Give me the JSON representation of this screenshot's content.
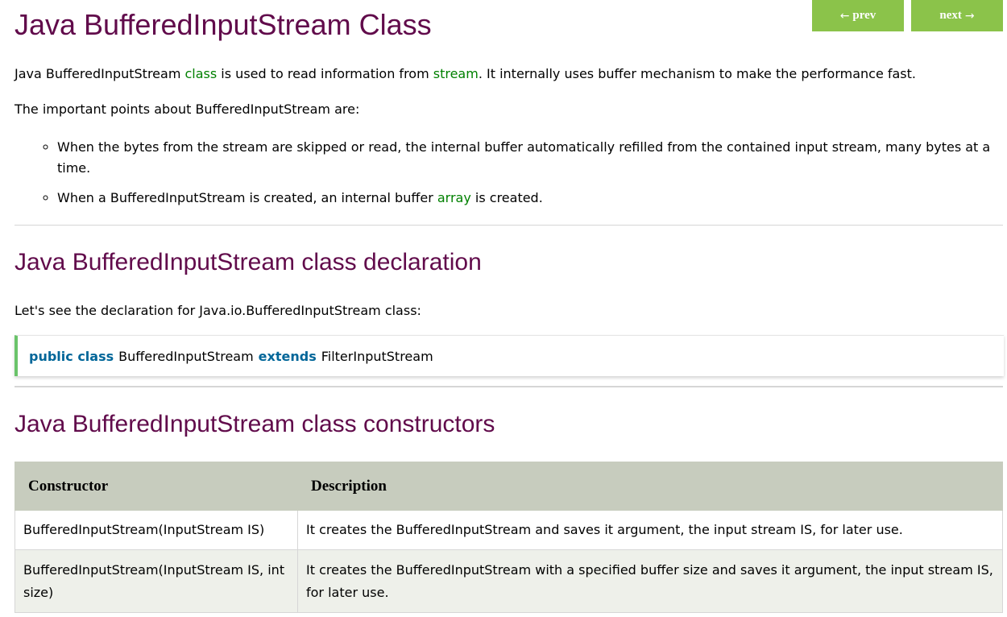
{
  "title": "Java BufferedInputStream Class",
  "nav": {
    "prev": "prev",
    "next": "next",
    "prev_arrow": "←",
    "next_arrow": "→"
  },
  "intro": {
    "before_class": "Java BufferedInputStream ",
    "class_link": "class",
    "middle": " is used to read information from ",
    "stream_link": "stream",
    "after": ". It internally uses buffer mechanism to make the performance fast."
  },
  "points_heading": "The important points about BufferedInputStream are:",
  "points": {
    "p1": "When the bytes from the stream are skipped or read, the internal buffer automatically refilled from the contained input stream, many bytes at a time.",
    "p2_before": "When a BufferedInputStream is created, an internal buffer ",
    "p2_link": "array",
    "p2_after": " is created."
  },
  "declaration": {
    "heading": "Java BufferedInputStream class declaration",
    "text": "Let's see the declaration for Java.io.BufferedInputStream class:",
    "code": {
      "kw1": "public class",
      "name": "BufferedInputStream",
      "kw2": "extends",
      "parent": "FilterInputStream"
    }
  },
  "constructors": {
    "heading": "Java BufferedInputStream class constructors",
    "headers": {
      "constructor": "Constructor",
      "description": "Description"
    },
    "rows": [
      {
        "constructor": "BufferedInputStream(InputStream IS)",
        "description": "It creates the BufferedInputStream and saves it argument, the input stream IS, for later use."
      },
      {
        "constructor": "BufferedInputStream(InputStream IS, int size)",
        "description": "It creates the BufferedInputStream with a specified buffer size and saves it argument, the input stream IS, for later use."
      }
    ]
  },
  "colors": {
    "heading": "#610b4b",
    "link": "#008000",
    "nav_button": "#8bc34a",
    "keyword": "#006699",
    "table_header": "#c7ccbe"
  }
}
